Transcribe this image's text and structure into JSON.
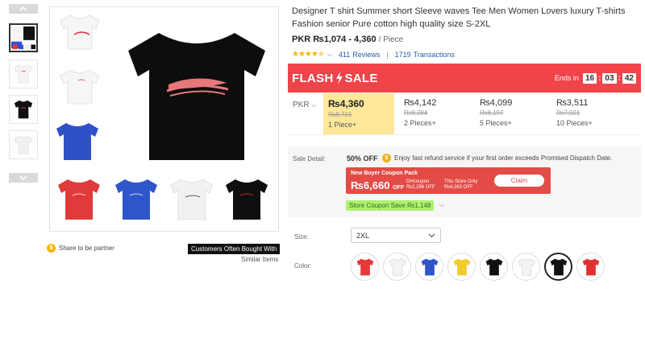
{
  "product": {
    "title": "Designer T shirt Summer short Sleeve waves Tee Men Women Lovers luxury T-shirts Fashion senior Pure cotton high quality size S-2XL",
    "price_range": "PKR ₨1,074 - 4,360",
    "price_unit": "/ Piece",
    "rating": 4.5,
    "reviews_count": "411",
    "reviews_label": "Reviews",
    "transactions_count": "1719",
    "transactions_label": "Transactions"
  },
  "flash_sale": {
    "label_left": "FLASH",
    "label_right": "SALE",
    "ends_label": "Ends in",
    "hours": "16",
    "minutes": "03",
    "seconds": "42"
  },
  "tiers": {
    "currency": "PKR",
    "items": [
      {
        "price": "₨4,360",
        "original": "₨8,721",
        "qty": "1 Piece+"
      },
      {
        "price": "₨4,142",
        "original": "₨8,284",
        "qty": "2 Pieces+"
      },
      {
        "price": "₨4,099",
        "original": "₨8,197",
        "qty": "5 Pieces+"
      },
      {
        "price": "₨3,511",
        "original": "₨7,021",
        "qty": "10 Pieces+"
      }
    ]
  },
  "sale_detail": {
    "label": "Sale Detail:",
    "off": "50% OFF",
    "refund_text": "Enjoy fast refund service if your first order exceeds Promised Dispatch Date.",
    "coupon_header": "New Buyer Coupon Pack",
    "coupon_amount": "₨6,660",
    "coupon_off": "OFF",
    "coupon_d1_line1": "DHcoupon",
    "coupon_d1_line2": "₨2,296 OFF",
    "coupon_d2_line1": "This Store Only",
    "coupon_d2_line2": "₨4,363 OFF",
    "claim_label": "Claim",
    "store_coupon": "Store Coupon Save ₨1,148"
  },
  "options": {
    "size_label": "Size:",
    "size_value": "2XL",
    "color_label": "Color:",
    "colors": [
      "#e43a3a",
      "#f3f3f3",
      "#2f56c8",
      "#f2cc2e",
      "#111111",
      "#f3f3f3",
      "#111111",
      "#e0302f"
    ]
  },
  "footer": {
    "share_label": "Share to be partner",
    "bought_label": "Customers Often Bought With",
    "similar_label": "Similar Items"
  }
}
